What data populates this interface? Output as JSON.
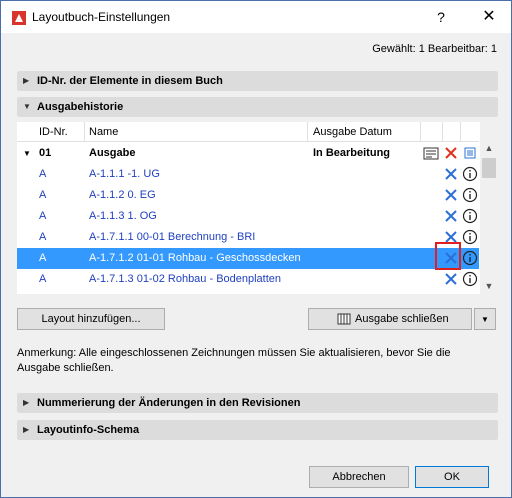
{
  "window": {
    "title": "Layoutbuch-Einstellungen",
    "help_label": "?",
    "close_label": "✕"
  },
  "summary": "Gewählt: 1 Bearbeitbar: 1",
  "sections": {
    "id_elements": "ID-Nr. der Elemente in diesem Buch",
    "history": "Ausgabehistorie",
    "numbering": "Nummerierung der Änderungen in den Revisionen",
    "layoutinfo": "Layoutinfo-Schema"
  },
  "table": {
    "headers": {
      "id": "ID-Nr.",
      "name": "Name",
      "date": "Ausgabe Datum"
    },
    "group": {
      "id": "01",
      "name": "Ausgabe",
      "status": "In Bearbeitung"
    },
    "rows": [
      {
        "id": "A",
        "name": "A-1.1.1 -1. UG"
      },
      {
        "id": "A",
        "name": "A-1.1.2 0. EG"
      },
      {
        "id": "A",
        "name": "A-1.1.3 1. OG"
      },
      {
        "id": "A",
        "name": "A-1.7.1.1 00-01 Berechnung - BRI"
      },
      {
        "id": "A",
        "name": "A-1.7.1.2 01-01 Rohbau - Geschossdecken",
        "selected": true
      },
      {
        "id": "A",
        "name": "A-1.7.1.3 01-02 Rohbau - Bodenplatten"
      }
    ]
  },
  "buttons": {
    "add_layout": "Layout hinzufügen...",
    "close_issue": "Ausgabe schließen",
    "cancel": "Abbrechen",
    "ok": "OK"
  },
  "note": "Anmerkung: Alle eingeschlossenen Zeichnungen müssen Sie aktualisieren, bevor Sie die Ausgabe schließen.",
  "colors": {
    "accent": "#3399ff",
    "link": "#1f3fbf",
    "remove": "#2b6fd6",
    "remove_header": "#e0301e",
    "highlight": "#e02020"
  },
  "icons": [
    "app-icon",
    "help-icon",
    "close-icon",
    "triangle-right-icon",
    "triangle-down-icon",
    "remove-x-icon",
    "info-icon",
    "issue-icon",
    "dropdown-arrow-icon"
  ]
}
